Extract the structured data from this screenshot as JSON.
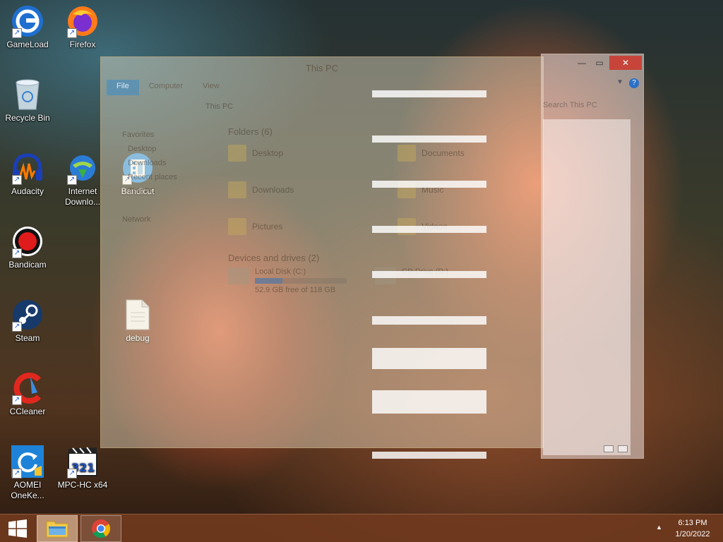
{
  "desktop": {
    "icons": [
      {
        "label": "GameLoad"
      },
      {
        "label": "Firefox"
      },
      {
        "label": "Recycle Bin"
      },
      {
        "label": "Audacity"
      },
      {
        "label": "Internet Downlo..."
      },
      {
        "label": "Bandicut"
      },
      {
        "label": "Bandicam"
      },
      {
        "label": "Steam"
      },
      {
        "label": "debug"
      },
      {
        "label": "CCleaner"
      },
      {
        "label": "AOMEI OneKe..."
      },
      {
        "label": "MPC-HC x64"
      }
    ]
  },
  "explorer": {
    "title": "This PC",
    "ribbon": {
      "file": "File",
      "computer": "Computer",
      "view": "View"
    },
    "address": "This PC",
    "search_placeholder": "Search This PC",
    "nav": {
      "favorites": "Favorites",
      "desktop": "Desktop",
      "downloads": "Downloads",
      "recent": "Recent places",
      "this_pc": "This PC",
      "network": "Network"
    },
    "folders_header": "Folders (6)",
    "folders": [
      "Desktop",
      "Documents",
      "Downloads",
      "Music",
      "Pictures",
      "Videos"
    ],
    "devices_header": "Devices and drives (2)",
    "drives": [
      {
        "name": "Local Disk (C:)",
        "free": "52.9 GB free of 118 GB",
        "used_fraction": 0.3
      },
      {
        "name": "CD Drive (D:)"
      }
    ]
  },
  "taskbar": {
    "time": "6:13 PM",
    "date": "1/20/2022"
  },
  "colors": {
    "taskbar": "#703a1e",
    "close_button": "#c7443a",
    "accent_blue": "#2b6fc7"
  }
}
